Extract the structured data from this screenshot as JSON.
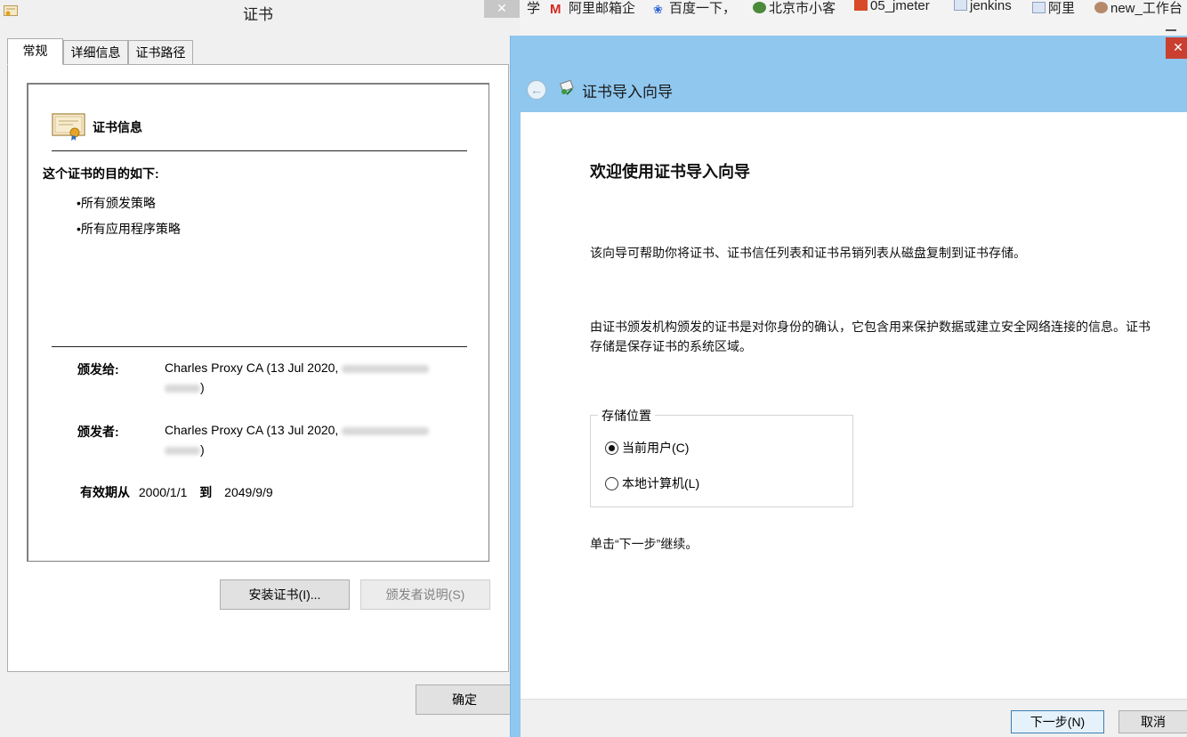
{
  "cert_dialog": {
    "title": "证书",
    "close_glyph": "✕",
    "tabs": [
      "常规",
      "详细信息",
      "证书路径"
    ],
    "info_heading": "证书信息",
    "purpose_heading": "这个证书的目的如下:",
    "purposes": [
      "•所有颁发策略",
      "•所有应用程序策略"
    ],
    "issued_to_label": "颁发给:",
    "issued_to_value": "Charles Proxy CA (13 Jul 2020, ",
    "issued_to_tail": ")",
    "issued_by_label": "颁发者:",
    "issued_by_value": "Charles Proxy CA (13 Jul 2020, ",
    "issued_by_tail": ")",
    "valid_from_label": "有效期从",
    "valid_from": "2000/1/1",
    "valid_to_label": "到",
    "valid_to": "2049/9/9",
    "install_button": "安装证书(I)...",
    "issuer_statement_button": "颁发者说明(S)",
    "ok_button": "确定"
  },
  "bookmarks": [
    {
      "label": "学",
      "icon": "text"
    },
    {
      "label": "阿里邮箱企",
      "icon": "mail-icon"
    },
    {
      "label": "百度一下，",
      "icon": "baidu-icon"
    },
    {
      "label": "北京市小客",
      "icon": "globe-icon"
    },
    {
      "label": "05_jmeter",
      "icon": "bookmark-icon"
    },
    {
      "label": "jenkins",
      "icon": "folder-icon"
    },
    {
      "label": "阿里",
      "icon": "folder-icon"
    },
    {
      "label": "new_工作台",
      "icon": "avatar-icon"
    }
  ],
  "wizard": {
    "title": "证书导入向导",
    "close_glyph": "✕",
    "back_glyph": "←",
    "heading": "欢迎使用证书导入向导",
    "intro": "该向导可帮助你将证书、证书信任列表和证书吊销列表从磁盘复制到证书存储。",
    "explanation": "由证书颁发机构颁发的证书是对你身份的确认，它包含用来保护数据或建立安全网络连接的信息。证书存储是保存证书的系统区域。",
    "store_location_label": "存储位置",
    "options": [
      {
        "label": "当前用户(C)",
        "checked": true
      },
      {
        "label": "本地计算机(L)",
        "checked": false
      }
    ],
    "continue_hint": "单击“下一步”继续。",
    "next_button": "下一步(N)",
    "cancel_button": "取消"
  },
  "colors": {
    "wizard_header": "#8fc7ef",
    "close_red": "#c94030",
    "dialog_bg": "#f0f0f0"
  }
}
